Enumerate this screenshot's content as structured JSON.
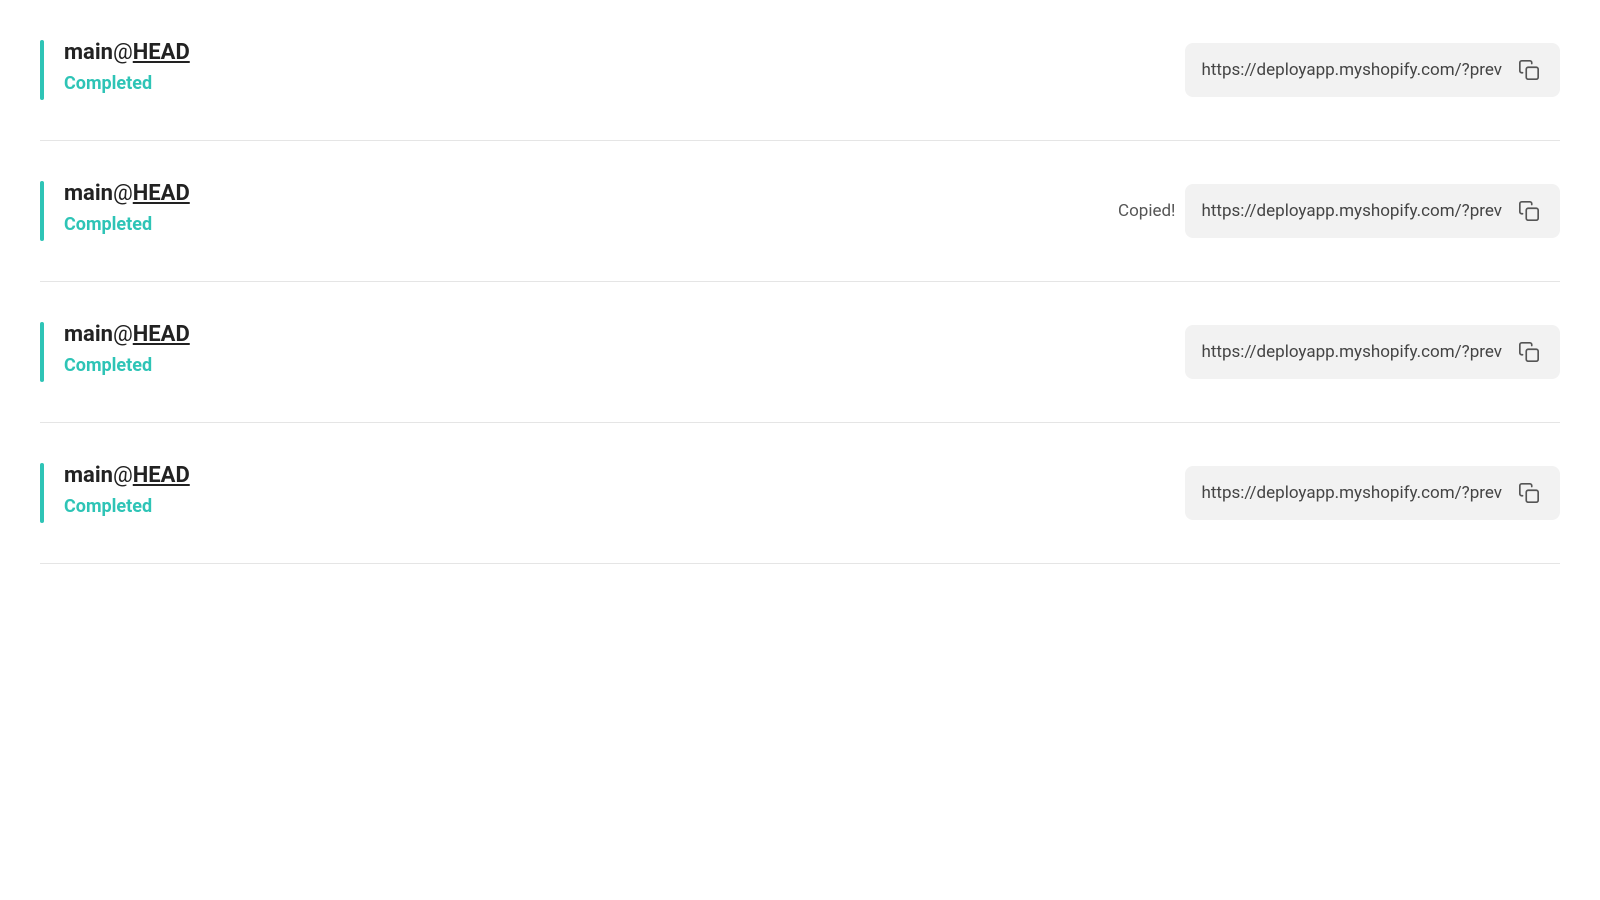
{
  "items": [
    {
      "id": "item-1",
      "branch": "main",
      "at_sign": "@",
      "ref": "HEAD",
      "status": "Completed",
      "url": "https://deployapp.myshopify.com/?prev",
      "show_copied": false
    },
    {
      "id": "item-2",
      "branch": "main",
      "at_sign": "@",
      "ref": "HEAD",
      "status": "Completed",
      "url": "https://deployapp.myshopify.com/?prev",
      "show_copied": true,
      "copied_label": "Copied!"
    },
    {
      "id": "item-3",
      "branch": "main",
      "at_sign": "@",
      "ref": "HEAD",
      "status": "Completed",
      "url": "https://deployapp.myshopify.com/?prev",
      "show_copied": false
    },
    {
      "id": "item-4",
      "branch": "main",
      "at_sign": "@",
      "ref": "HEAD",
      "status": "Completed",
      "url": "https://deployapp.myshopify.com/?prev",
      "show_copied": false
    }
  ]
}
